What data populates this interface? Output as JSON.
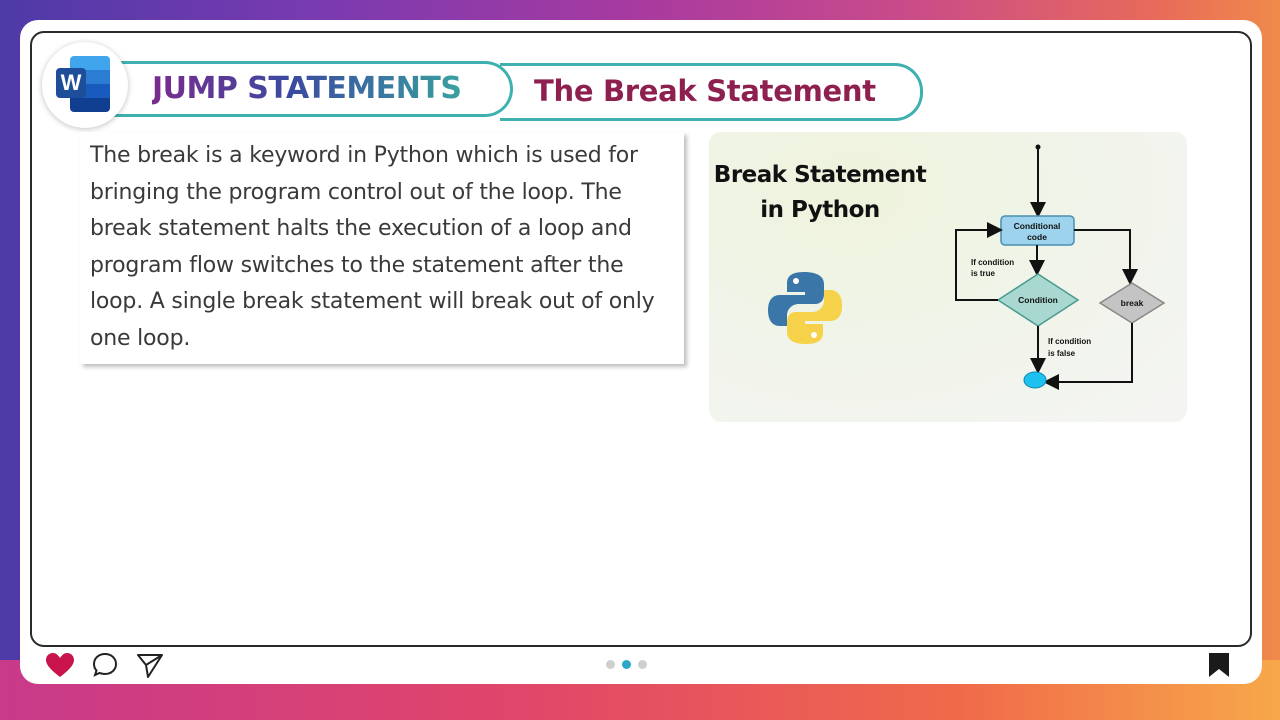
{
  "header": {
    "app_icon": "word-icon",
    "app_icon_letter": "W",
    "section_title": "JUMP STATEMENTS",
    "slide_title": "The Break Statement"
  },
  "body_text": "The break is a keyword in Python which is used for bringing the program control out of the loop. The break statement halts the execution of a loop and program flow switches to the statement after the loop. A single break statement will break out of only one loop.",
  "diagram": {
    "title_line1": "Break Statement",
    "title_line2": "in Python",
    "logo": "python-logo",
    "flow": {
      "conditional_line1": "Conditional",
      "conditional_line2": "code",
      "true_line1": "If condition",
      "true_line2": "is true",
      "condition": "Condition",
      "break": "break",
      "false_line1": "If condition",
      "false_line2": "is false"
    }
  },
  "footer": {
    "like_icon": "heart-icon",
    "comment_icon": "comment-icon",
    "share_icon": "send-icon",
    "bookmark_icon": "bookmark-icon",
    "pagination": {
      "total": 3,
      "active": 2
    }
  },
  "colors": {
    "accent_teal": "#3fb0b0",
    "title_red": "#8e2050",
    "heart": "#c8144a",
    "dot_active": "#2aa6c8",
    "dot_inactive": "#cfcfcf"
  }
}
